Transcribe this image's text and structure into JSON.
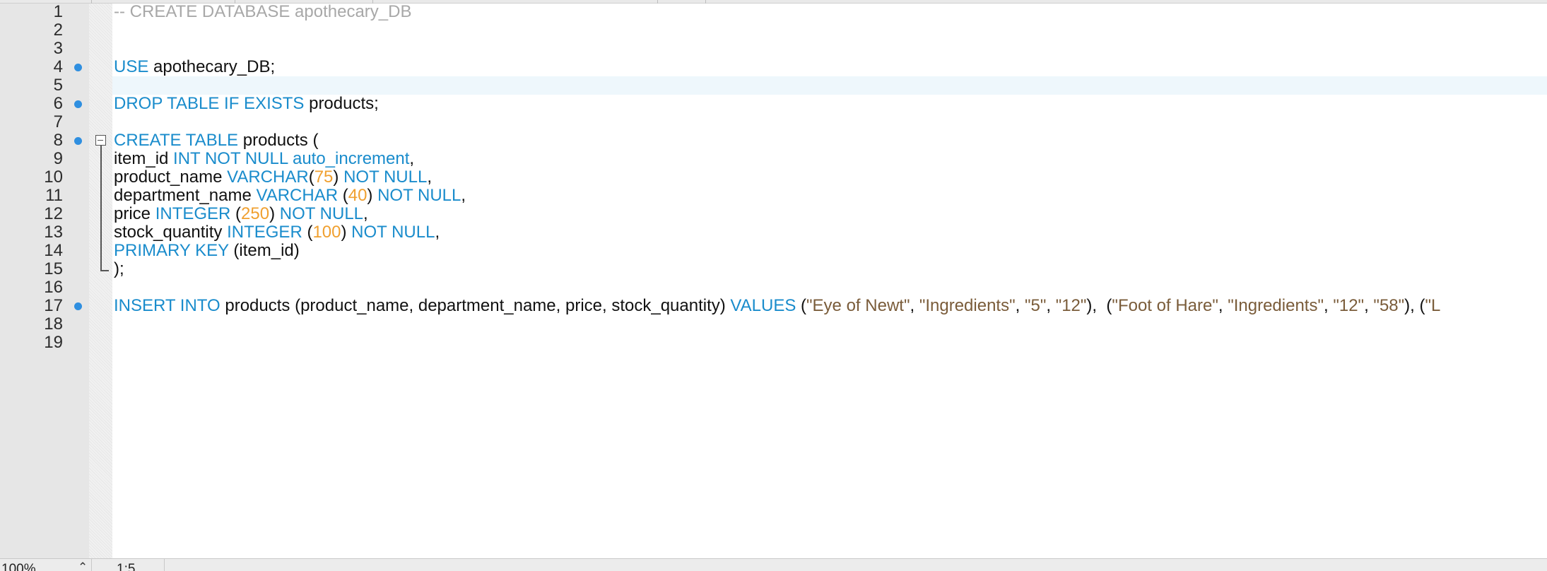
{
  "editor": {
    "current_line": 5,
    "line_numbers": [
      "1",
      "2",
      "3",
      "4",
      "5",
      "6",
      "7",
      "8",
      "9",
      "10",
      "11",
      "12",
      "13",
      "14",
      "15",
      "16",
      "17",
      "18",
      "19"
    ],
    "markers": [
      4,
      6,
      8,
      17
    ],
    "lines": [
      [
        {
          "t": "cm",
          "v": "-- CREATE DATABASE apothecary_DB"
        }
      ],
      [],
      [],
      [
        {
          "t": "kw",
          "v": "USE"
        },
        {
          "t": "tx",
          "v": " apothecary_DB;"
        }
      ],
      [],
      [
        {
          "t": "kw",
          "v": "DROP TABLE IF EXISTS"
        },
        {
          "t": "tx",
          "v": " products;"
        }
      ],
      [],
      [
        {
          "t": "kw",
          "v": "CREATE TABLE"
        },
        {
          "t": "tx",
          "v": " products ("
        }
      ],
      [
        {
          "t": "tx",
          "v": "item_id "
        },
        {
          "t": "kw",
          "v": "INT NOT NULL auto_increment"
        },
        {
          "t": "tx",
          "v": ","
        }
      ],
      [
        {
          "t": "tx",
          "v": "product_name "
        },
        {
          "t": "kw",
          "v": "VARCHAR"
        },
        {
          "t": "tx",
          "v": "("
        },
        {
          "t": "num",
          "v": "75"
        },
        {
          "t": "tx",
          "v": ") "
        },
        {
          "t": "kw",
          "v": "NOT NULL"
        },
        {
          "t": "tx",
          "v": ","
        }
      ],
      [
        {
          "t": "tx",
          "v": "department_name "
        },
        {
          "t": "kw",
          "v": "VARCHAR"
        },
        {
          "t": "tx",
          "v": " ("
        },
        {
          "t": "num",
          "v": "40"
        },
        {
          "t": "tx",
          "v": ") "
        },
        {
          "t": "kw",
          "v": "NOT NULL"
        },
        {
          "t": "tx",
          "v": ","
        }
      ],
      [
        {
          "t": "tx",
          "v": "price "
        },
        {
          "t": "kw",
          "v": "INTEGER"
        },
        {
          "t": "tx",
          "v": " ("
        },
        {
          "t": "num",
          "v": "250"
        },
        {
          "t": "tx",
          "v": ") "
        },
        {
          "t": "kw",
          "v": "NOT NULL"
        },
        {
          "t": "tx",
          "v": ","
        }
      ],
      [
        {
          "t": "tx",
          "v": "stock_quantity "
        },
        {
          "t": "kw",
          "v": "INTEGER"
        },
        {
          "t": "tx",
          "v": " ("
        },
        {
          "t": "num",
          "v": "100"
        },
        {
          "t": "tx",
          "v": ") "
        },
        {
          "t": "kw",
          "v": "NOT NULL"
        },
        {
          "t": "tx",
          "v": ","
        }
      ],
      [
        {
          "t": "kw",
          "v": "PRIMARY KEY"
        },
        {
          "t": "tx",
          "v": " (item_id)"
        }
      ],
      [
        {
          "t": "tx",
          "v": ");"
        }
      ],
      [],
      [
        {
          "t": "kw",
          "v": "INSERT INTO"
        },
        {
          "t": "tx",
          "v": " products (product_name, department_name, price, stock_quantity) "
        },
        {
          "t": "kw",
          "v": "VALUES"
        },
        {
          "t": "tx",
          "v": " ("
        },
        {
          "t": "str",
          "v": "\"Eye of Newt\""
        },
        {
          "t": "tx",
          "v": ", "
        },
        {
          "t": "str",
          "v": "\"Ingredients\""
        },
        {
          "t": "tx",
          "v": ", "
        },
        {
          "t": "str",
          "v": "\"5\""
        },
        {
          "t": "tx",
          "v": ", "
        },
        {
          "t": "str",
          "v": "\"12\""
        },
        {
          "t": "tx",
          "v": "),  ("
        },
        {
          "t": "str",
          "v": "\"Foot of Hare\""
        },
        {
          "t": "tx",
          "v": ", "
        },
        {
          "t": "str",
          "v": "\"Ingredients\""
        },
        {
          "t": "tx",
          "v": ", "
        },
        {
          "t": "str",
          "v": "\"12\""
        },
        {
          "t": "tx",
          "v": ", "
        },
        {
          "t": "str",
          "v": "\"58\""
        },
        {
          "t": "tx",
          "v": "), ("
        },
        {
          "t": "str",
          "v": "\"L"
        }
      ],
      [],
      []
    ]
  },
  "status_bar": {
    "zoom": "100%",
    "cursor_position": "1:5"
  },
  "colors": {
    "keyword": "#1a8ccc",
    "number": "#f0a030",
    "string": "#7a5c3a",
    "comment": "#a8a8a8",
    "marker": "#2f8fe0",
    "current_line_bg": "#eef7fc"
  },
  "icons": {
    "marker": "breakpoint-dot-icon",
    "fold": "fold-collapse-icon",
    "zoom_chevron": "chevron-up-icon"
  }
}
